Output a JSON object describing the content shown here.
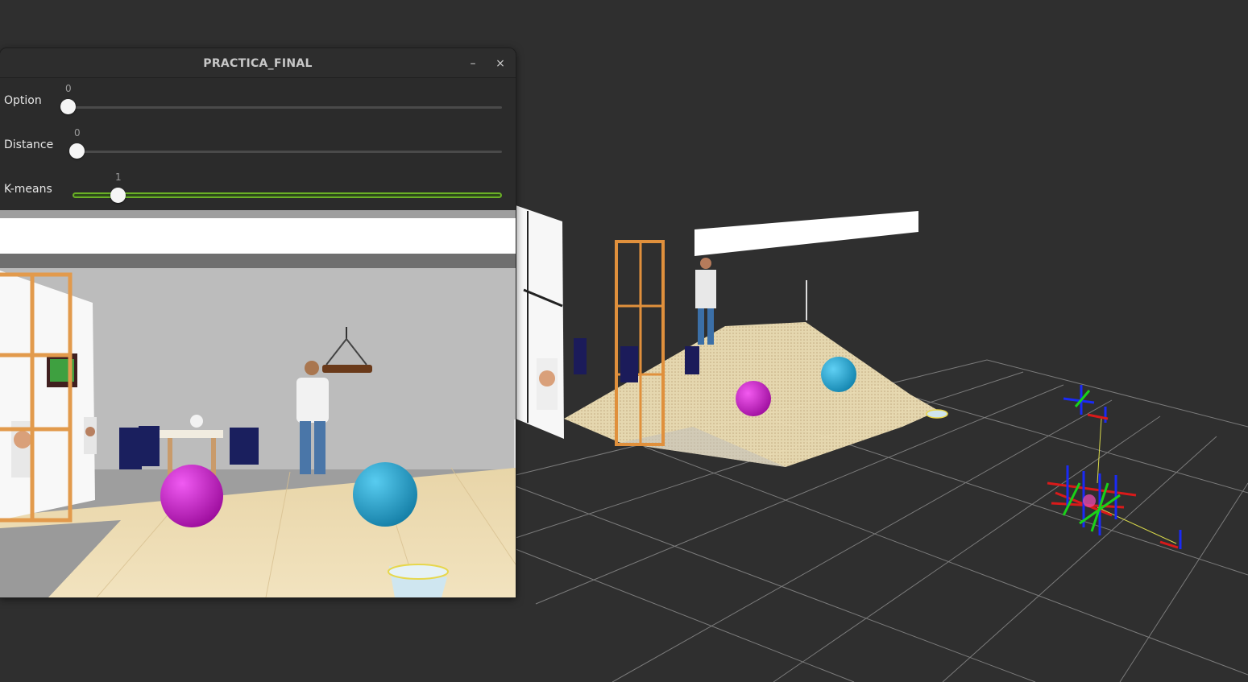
{
  "window": {
    "title": "PRACTICA_FINAL",
    "minimize_glyph": "–",
    "close_glyph": "×"
  },
  "trackbars": [
    {
      "label": "Option",
      "value": "0"
    },
    {
      "label": "Distance",
      "value": "0"
    },
    {
      "label": "K-means",
      "value": "1"
    }
  ],
  "icons": {
    "minimize": "minimize-icon",
    "close": "close-icon"
  },
  "colors": {
    "desktop_bg": "#2f2f2f",
    "grid": "#7a7a7a",
    "magenta_ball": "#d21ed2",
    "cyan_ball": "#1ea9d6",
    "trackbar_active": "#6ab026",
    "floor": "#e9d3a4"
  }
}
